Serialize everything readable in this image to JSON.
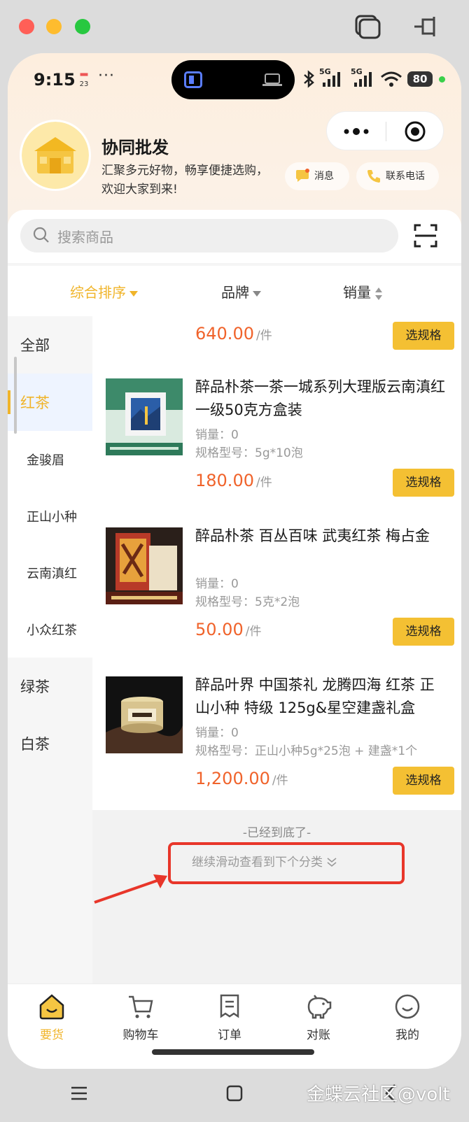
{
  "status_bar": {
    "time": "9:15",
    "calendar_day": "23",
    "more": "···",
    "battery": "80",
    "network_1": "5G",
    "network_2": "5G"
  },
  "shop": {
    "name": "协同批发",
    "description": "汇聚多元好物，畅享便捷选购，欢迎大家到来!"
  },
  "header_actions": {
    "message": "消息",
    "contact": "联系电话"
  },
  "search": {
    "placeholder": "搜索商品"
  },
  "sort": {
    "comprehensive": "综合排序",
    "brand": "品牌",
    "sales": "销量"
  },
  "sidebar": {
    "items": [
      {
        "label": "全部"
      },
      {
        "label": "红茶"
      },
      {
        "label": "金骏眉"
      },
      {
        "label": "正山小种"
      },
      {
        "label": "云南滇红"
      },
      {
        "label": "小众红茶"
      },
      {
        "label": "绿茶"
      },
      {
        "label": "白茶"
      }
    ]
  },
  "products": [
    {
      "price": "640.00",
      "unit": "/件",
      "button": "选规格"
    },
    {
      "title": "醉品朴茶一茶一城系列大理版云南滇红一级50克方盒装",
      "sales": "销量：0",
      "spec": "规格型号：5g*10泡",
      "price": "180.00",
      "unit": "/件",
      "button": "选规格"
    },
    {
      "title": "醉品朴茶 百丛百味 武夷红茶 梅占金",
      "sales": "销量：0",
      "spec": "规格型号：5克*2泡",
      "price": "50.00",
      "unit": "/件",
      "button": "选规格"
    },
    {
      "title": "醉品叶界 中国茶礼 龙腾四海 红茶 正山小种 特级 125g&星空建盏礼盒",
      "sales": "销量：0",
      "spec": "规格型号：正山小种5g*25泡 + 建盏*1个",
      "price": "1,200.00",
      "unit": "/件",
      "button": "选规格"
    }
  ],
  "list_footer": {
    "end": "-已经到底了-",
    "continue": "继续滑动查看到下个分类"
  },
  "tabbar": {
    "items": [
      {
        "label": "要货"
      },
      {
        "label": "购物车"
      },
      {
        "label": "订单"
      },
      {
        "label": "对账"
      },
      {
        "label": "我的"
      }
    ]
  },
  "watermark": "金蝶云社区@volt",
  "colors": {
    "accent": "#f0b429",
    "price": "#f0632b",
    "annotation_red": "#e8362a",
    "spec_button": "#f4c033"
  }
}
